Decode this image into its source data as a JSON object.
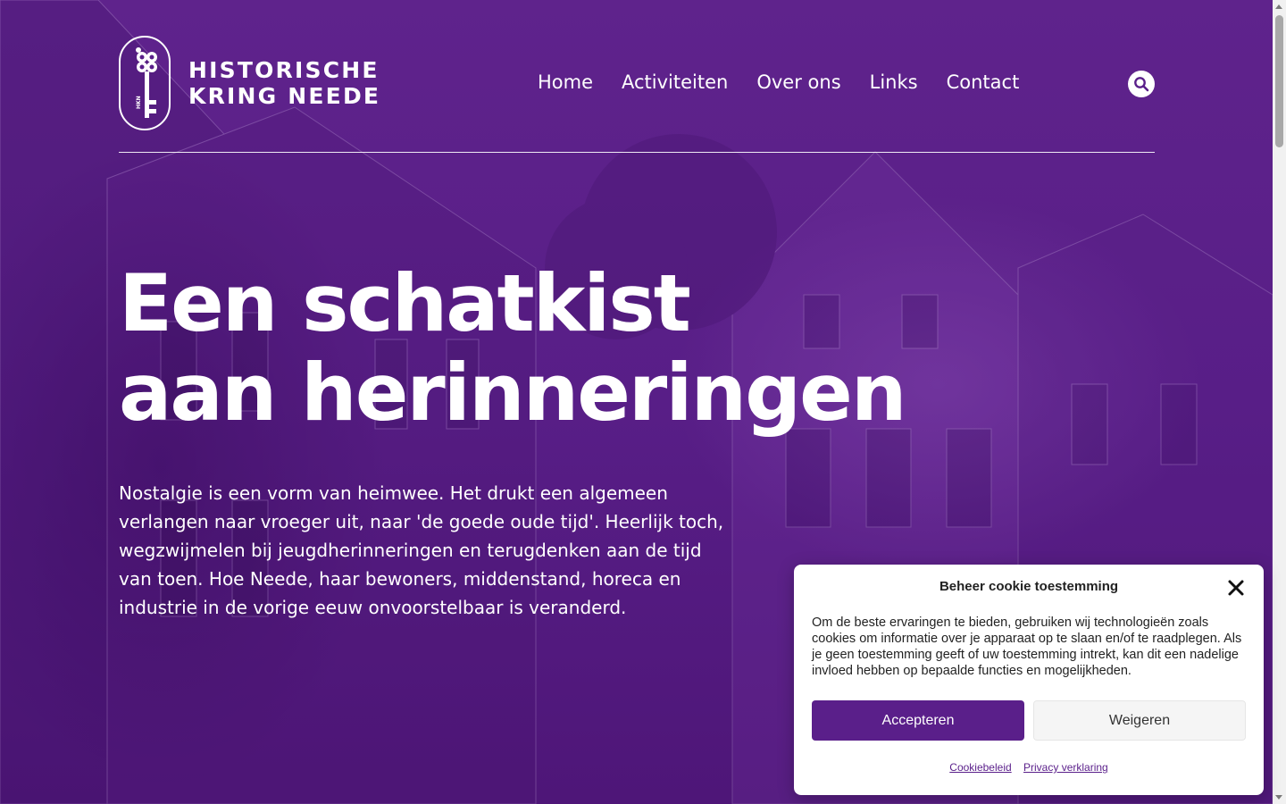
{
  "site": {
    "logo_line1": "HISTORISCHE",
    "logo_line2": "KRING NEEDE",
    "logo_badge_text": "HKN"
  },
  "nav": {
    "items": [
      {
        "label": "Home"
      },
      {
        "label": "Activiteiten"
      },
      {
        "label": "Over ons"
      },
      {
        "label": "Links"
      },
      {
        "label": "Contact"
      }
    ],
    "search_icon": "search-icon"
  },
  "hero": {
    "title_line1": "Een schatkist",
    "title_line2": "aan herinneringen",
    "text": "Nostalgie is een vorm van heimwee. Het drukt een algemeen verlangen naar vroeger uit, naar 'de goede oude tijd'. Heerlijk toch, wegzwijmelen bij jeugdherinneringen en terugdenken aan de tijd van toen. Hoe Neede, haar bewoners, middenstand, horeca en industrie in de vorige eeuw onvoorstelbaar is veranderd."
  },
  "cookie": {
    "title": "Beheer cookie toestemming",
    "message": "Om de beste ervaringen te bieden, gebruiken wij technologieën zoals cookies om informatie over je apparaat op te slaan en/of te raadplegen. Als je geen toestemming geeft of uw toestemming intrekt, kan dit een nadelige invloed hebben op bepaalde functies en mogelijkheden.",
    "accept_label": "Accepteren",
    "deny_label": "Weigeren",
    "link_cookie_policy": "Cookiebeleid",
    "link_privacy": "Privacy verklaring"
  },
  "colors": {
    "brand_purple": "#5a1f8a",
    "text_white": "#ffffff"
  }
}
